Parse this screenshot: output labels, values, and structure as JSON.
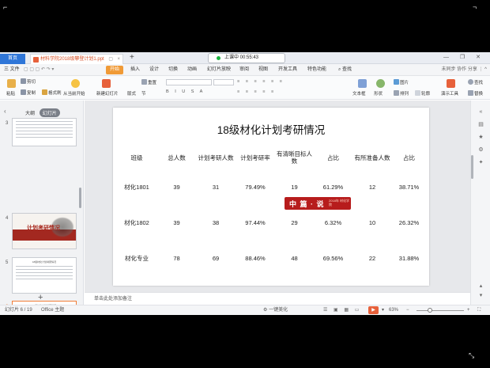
{
  "tabbar": {
    "home_tab": "首页",
    "document_tab": "材料学院2018级攀登计划1.ppt",
    "add_tab": "+",
    "live_status": "上课中 00:55:43",
    "window_controls": "— ❐ ✕"
  },
  "menubar": {
    "file_menu": "三 文件",
    "items": [
      "开始",
      "插入",
      "设计",
      "切换",
      "动画",
      "幻灯片放映",
      "审阅",
      "视图",
      "开发工具",
      "特色功能"
    ],
    "search": "查找",
    "right_items": "未同步  协作  分享  ⋮  ^"
  },
  "ribbon": {
    "cut": "剪切",
    "paste": "粘贴",
    "copy": "复制",
    "format_painter": "格式刷",
    "play_from_current": "从当前开始",
    "new_slide": "新建幻灯片",
    "layout": "版式",
    "section": "节",
    "reset": "重置",
    "picture": "图片",
    "textbox": "文本框",
    "shape": "形状",
    "arrange": "排列",
    "outline": "轮廓",
    "presenter_tools": "演示工具",
    "find": "查找",
    "replace": "替换"
  },
  "leftpanel": {
    "outline_tab": "大纲",
    "thumbs_tab": "幻灯片",
    "slide_numbers": [
      "3",
      "4",
      "5",
      "6"
    ],
    "slide4_title": "计划考研情况",
    "mini_title": "18级材化计划考研情况",
    "add_slide": "+"
  },
  "slide": {
    "title": "18级材化计划考研情况",
    "table": {
      "headers": [
        "班级",
        "总人数",
        "计划考研人数",
        "计划考研率",
        "有清晰目标人数",
        "占比",
        "有所准备人数",
        "占比"
      ],
      "rows": [
        [
          "材化1801",
          "39",
          "31",
          "79.49%",
          "19",
          "61.29%",
          "12",
          "38.71%"
        ],
        [
          "材化1802",
          "39",
          "38",
          "97.44%",
          "29",
          "6.32%",
          "10",
          "26.32%"
        ],
        [
          "材化专业",
          "78",
          "69",
          "88.46%",
          "48",
          "69.56%",
          "22",
          "31.88%"
        ]
      ]
    },
    "stamp": {
      "main": "中 篇 · 说",
      "sub": "2018年 材化学院"
    }
  },
  "notes": {
    "placeholder": "单击此处添加备注"
  },
  "statusbar": {
    "slide_counter": "幻灯片 6 / 19",
    "theme": "Office 主题",
    "beautify": "一键美化",
    "zoom": "63%",
    "zoom_minus": "−",
    "zoom_plus": "+"
  },
  "colors": {
    "accent_orange": "#f07d37",
    "wps_blue": "#2f76d8",
    "stamp_red": "#b71c1c"
  }
}
